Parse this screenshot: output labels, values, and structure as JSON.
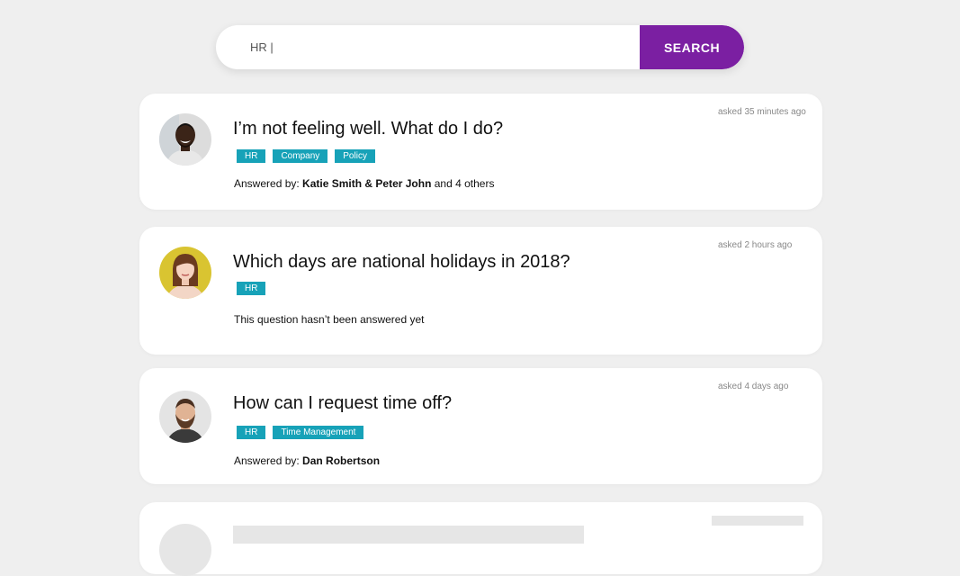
{
  "search": {
    "value": "HR |",
    "button_label": "SEARCH"
  },
  "questions": [
    {
      "title": "I’m not feeling well. What do I do?",
      "time": "asked 35 minutes ago",
      "tags": [
        "HR",
        "Company",
        "Policy"
      ],
      "answer_prefix": "Answered by: ",
      "answer_names": "Katie Smith & Peter John",
      "answer_suffix": " and 4 others",
      "avatar": "avatar-man-smiling"
    },
    {
      "title": "Which days are national holidays in 2018?",
      "time": "asked 2 hours ago",
      "tags": [
        "HR"
      ],
      "answer_text": "This question hasn’t been answered yet",
      "avatar": "avatar-woman"
    },
    {
      "title": "How can I request time off?",
      "time": "asked 4 days ago",
      "tags": [
        "HR",
        "Time Management"
      ],
      "answer_prefix": "Answered by: ",
      "answer_names": "Dan Robertson",
      "avatar": "avatar-bearded-man"
    }
  ],
  "colors": {
    "accent": "#7b1fa2",
    "tag": "#17a2b8",
    "background": "#efefef",
    "placeholder": "#e6e6e6"
  }
}
